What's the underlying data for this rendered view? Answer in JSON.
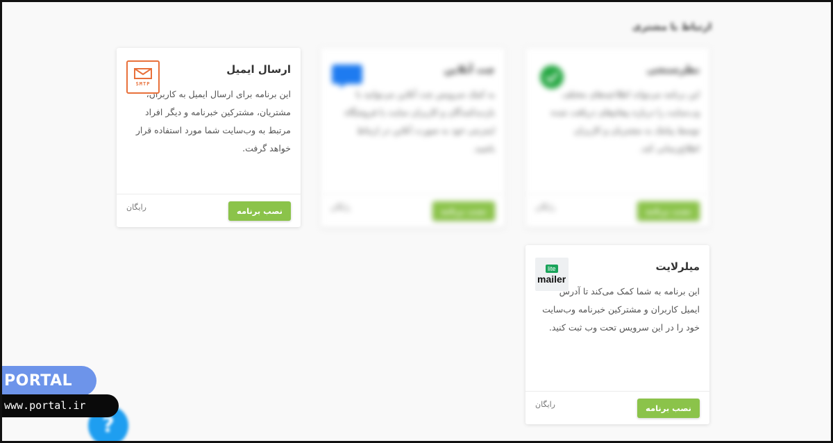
{
  "section": {
    "title": "ارتباط با مشتری"
  },
  "cards": [
    {
      "title": "ارسال ایمیل",
      "logo": "smtp-envelope-icon",
      "logo_text": "SMTP",
      "description": "این برنامه برای ارسال ایمیل به کاربران، مشتریان، مشترکین خبرنامه و دیگر افراد مرتبط به وب‌سایت شما مورد استفاده قرار خواهد گرفت.",
      "install_label": "نصب برنامه",
      "price": "رایگان"
    },
    {
      "title": "چت آنلاین",
      "logo": "chat-bubble-icon",
      "description": "به کمک سرویس چت آنلاین می‌توانید با بازدیدکنندگان و کاربران سایت یا فروشگاه اینترنتی خود به صورت آنلاین در ارتباط باشید.",
      "install_label": "نصب برنامه",
      "price": "رایگان"
    },
    {
      "title": "نظرسنجی",
      "logo": "poll-check-icon",
      "description": "این برنامه می‌تواند اطلاعیه‌های مختلف وب‌سایت را درباره پیغام‌های دریافت شده توسط پیامک به مشتریان و کاربران اطلاع‌رسانی کند.",
      "install_label": "نصب برنامه",
      "price": "رایگان"
    },
    {
      "title": "میلرلایت",
      "logo": "mailerlite-logo",
      "logo_text_top": "lite",
      "logo_text_bottom": "mailer",
      "description": "این برنامه به شما کمک می‌کند تا آدرس ایمیل کاربران و مشترکین خبرنامه وب‌سایت خود را در این سرویس تحت وب ثبت کنید.",
      "install_label": "نصب برنامه",
      "price": "رایگان"
    }
  ],
  "watermark": {
    "brand": "PORTAL",
    "url": "www.portal.ir"
  },
  "help": {
    "label": "?"
  },
  "colors": {
    "accent": "#8bc34a",
    "smtp": "#e8703a",
    "chat": "#1e7bf0",
    "poll": "#27a844",
    "brand_badge": "#6d94ea"
  }
}
